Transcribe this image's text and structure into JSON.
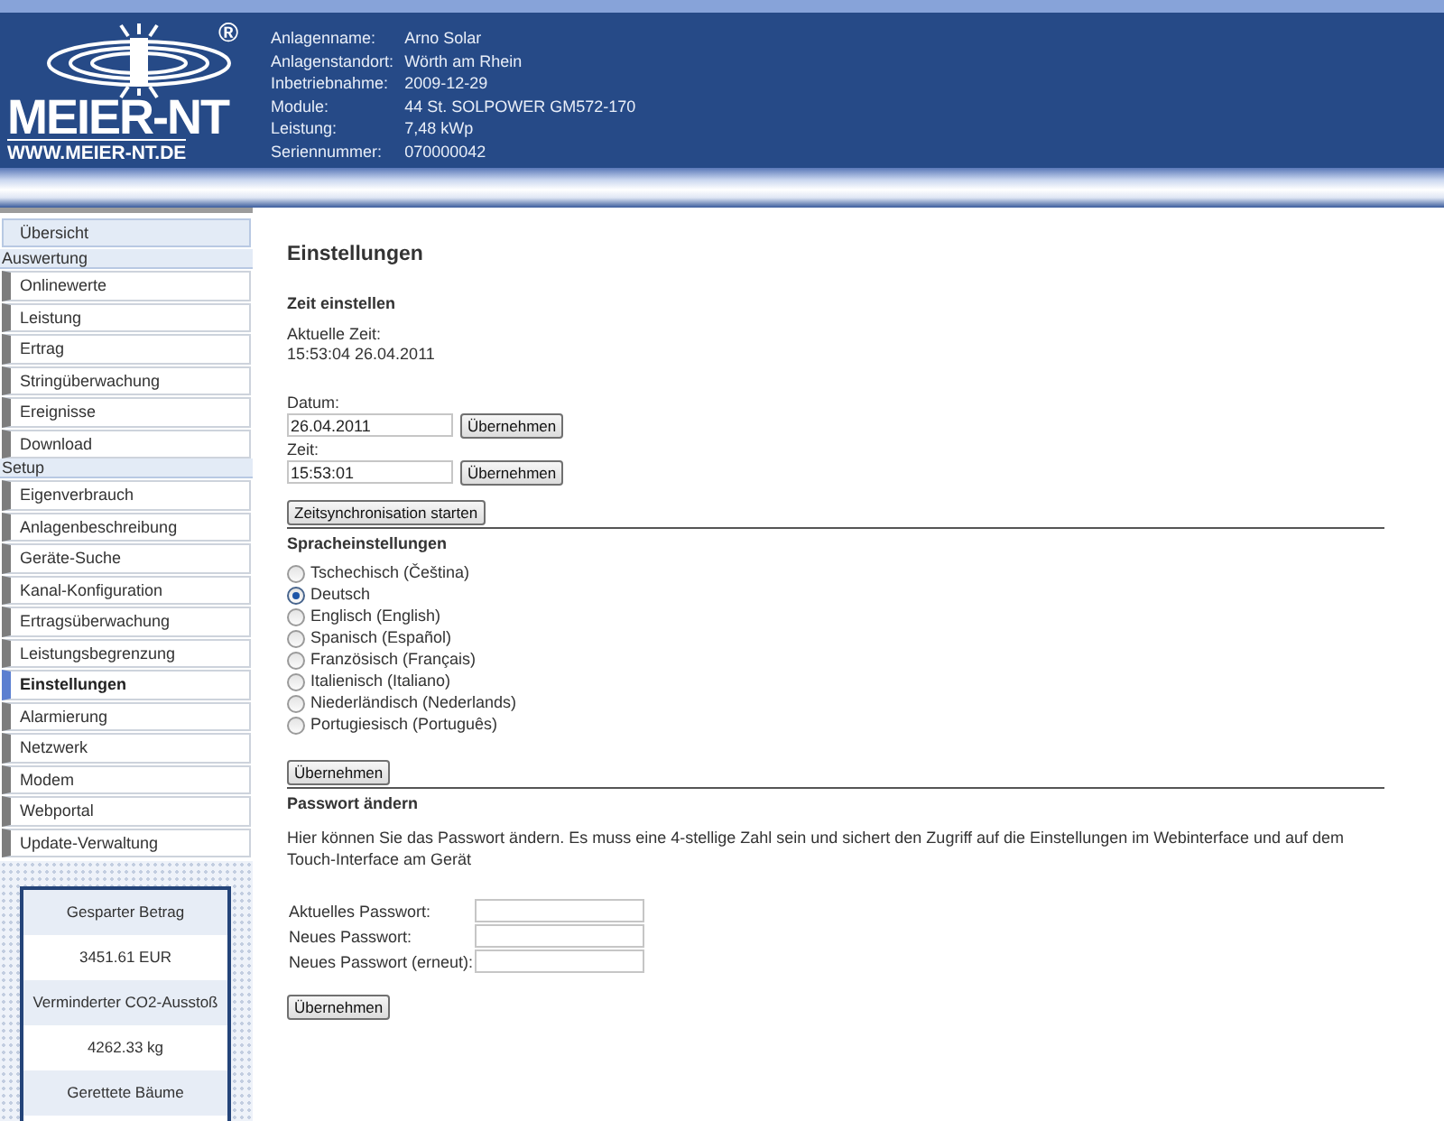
{
  "header": {
    "logo": {
      "registered": "®",
      "name": "MEIER-NT",
      "url": "WWW.MEIER-NT.DE"
    },
    "info": [
      {
        "label": "Anlagenname:",
        "value": "Arno Solar"
      },
      {
        "label": "Anlagenstandort:",
        "value": "Wörth am Rhein"
      },
      {
        "label": "Inbetriebnahme:",
        "value": "2009-12-29"
      },
      {
        "label": "Module:",
        "value": "44 St. SOLPOWER GM572-170"
      },
      {
        "label": "Leistung:",
        "value": "7,48 kWp"
      },
      {
        "label": "Seriennummer:",
        "value": "070000042"
      }
    ]
  },
  "sidebar": {
    "items": [
      {
        "kind": "overview",
        "label": "Übersicht",
        "selected": false
      },
      {
        "kind": "group",
        "label": "Auswertung"
      },
      {
        "kind": "item",
        "label": "Onlinewerte",
        "selected": false
      },
      {
        "kind": "item",
        "label": "Leistung",
        "selected": false
      },
      {
        "kind": "item",
        "label": "Ertrag",
        "selected": false
      },
      {
        "kind": "item",
        "label": "Stringüberwachung",
        "selected": false
      },
      {
        "kind": "item",
        "label": "Ereignisse",
        "selected": false
      },
      {
        "kind": "item",
        "label": "Download",
        "selected": false
      },
      {
        "kind": "group",
        "label": "Setup"
      },
      {
        "kind": "item",
        "label": "Eigenverbrauch",
        "selected": false
      },
      {
        "kind": "item",
        "label": "Anlagenbeschreibung",
        "selected": false
      },
      {
        "kind": "item",
        "label": "Geräte-Suche",
        "selected": false
      },
      {
        "kind": "item",
        "label": "Kanal-Konfiguration",
        "selected": false
      },
      {
        "kind": "item",
        "label": "Ertragsüberwachung",
        "selected": false
      },
      {
        "kind": "item",
        "label": "Leistungsbegrenzung",
        "selected": false
      },
      {
        "kind": "item",
        "label": "Einstellungen",
        "selected": true
      },
      {
        "kind": "item",
        "label": "Alarmierung",
        "selected": false
      },
      {
        "kind": "item",
        "label": "Netzwerk",
        "selected": false
      },
      {
        "kind": "item",
        "label": "Modem",
        "selected": false
      },
      {
        "kind": "item",
        "label": "Webportal",
        "selected": false
      },
      {
        "kind": "item",
        "label": "Update-Verwaltung",
        "selected": false
      }
    ],
    "stats": [
      {
        "label": "Gesparter Betrag",
        "value": "3451.61 EUR"
      },
      {
        "label": "Verminderter CO2-Ausstoß",
        "value": "4262.33 kg"
      },
      {
        "label": "Gerettete Bäume"
      }
    ]
  },
  "main": {
    "title": "Einstellungen",
    "time": {
      "heading": "Zeit einstellen",
      "current_label": "Aktuelle Zeit:",
      "current_value": "15:53:04 26.04.2011",
      "fields": [
        {
          "label": "Datum:",
          "value": "26.04.2011",
          "button": "Übernehmen"
        },
        {
          "label": "Zeit:",
          "value": "15:53:01",
          "button": "Übernehmen"
        }
      ],
      "sync_button": "Zeitsynchronisation starten"
    },
    "language": {
      "heading": "Spracheinstellungen",
      "options": [
        {
          "label": "Tschechisch (Čeština)",
          "selected": false
        },
        {
          "label": "Deutsch",
          "selected": true
        },
        {
          "label": "Englisch (English)",
          "selected": false
        },
        {
          "label": "Spanisch (Español)",
          "selected": false
        },
        {
          "label": "Französisch (Français)",
          "selected": false
        },
        {
          "label": "Italienisch (Italiano)",
          "selected": false
        },
        {
          "label": "Niederländisch (Nederlands)",
          "selected": false
        },
        {
          "label": "Portugiesisch (Português)",
          "selected": false
        }
      ],
      "button": "Übernehmen"
    },
    "password": {
      "heading": "Passwort ändern",
      "description": "Hier können Sie das Passwort ändern. Es muss eine 4-stellige Zahl sein und sichert den Zugriff auf die Einstellungen im Webinterface und auf dem Touch-Interface am Gerät",
      "fields": [
        {
          "label": "Aktuelles Passwort:"
        },
        {
          "label": "Neues Passwort:"
        },
        {
          "label": "Neues Passwort (erneut):"
        }
      ],
      "button": "Übernehmen"
    }
  }
}
